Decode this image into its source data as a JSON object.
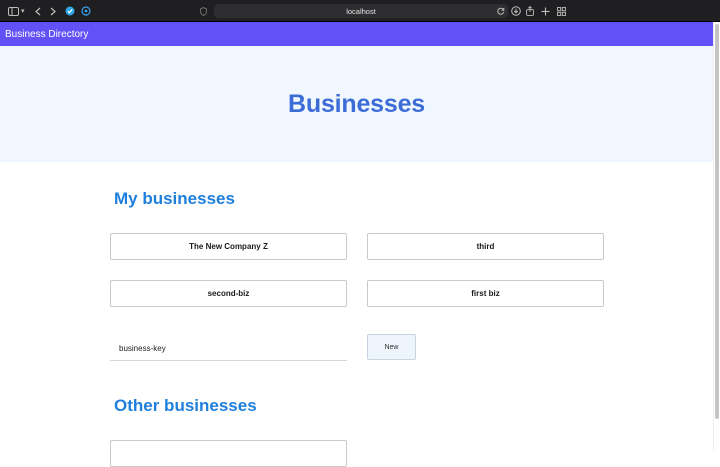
{
  "browser": {
    "url": "localhost",
    "icons": [
      "sidebar-icon",
      "chevron-down-icon",
      "back-icon",
      "forward-icon",
      "extension-icon",
      "extension-icon",
      "shield-icon",
      "reload-icon",
      "download-icon",
      "share-icon",
      "new-tab-icon",
      "tabs-overview-icon"
    ]
  },
  "app": {
    "title": "Business Directory",
    "accent": "#6151f7"
  },
  "hero": {
    "heading": "Businesses"
  },
  "my_businesses": {
    "title": "My businesses",
    "items": [
      "The New Company Z",
      "third",
      "second-biz",
      "first biz"
    ],
    "key_input_value": "business-key",
    "new_button": "New"
  },
  "other_businesses": {
    "title": "Other businesses"
  }
}
